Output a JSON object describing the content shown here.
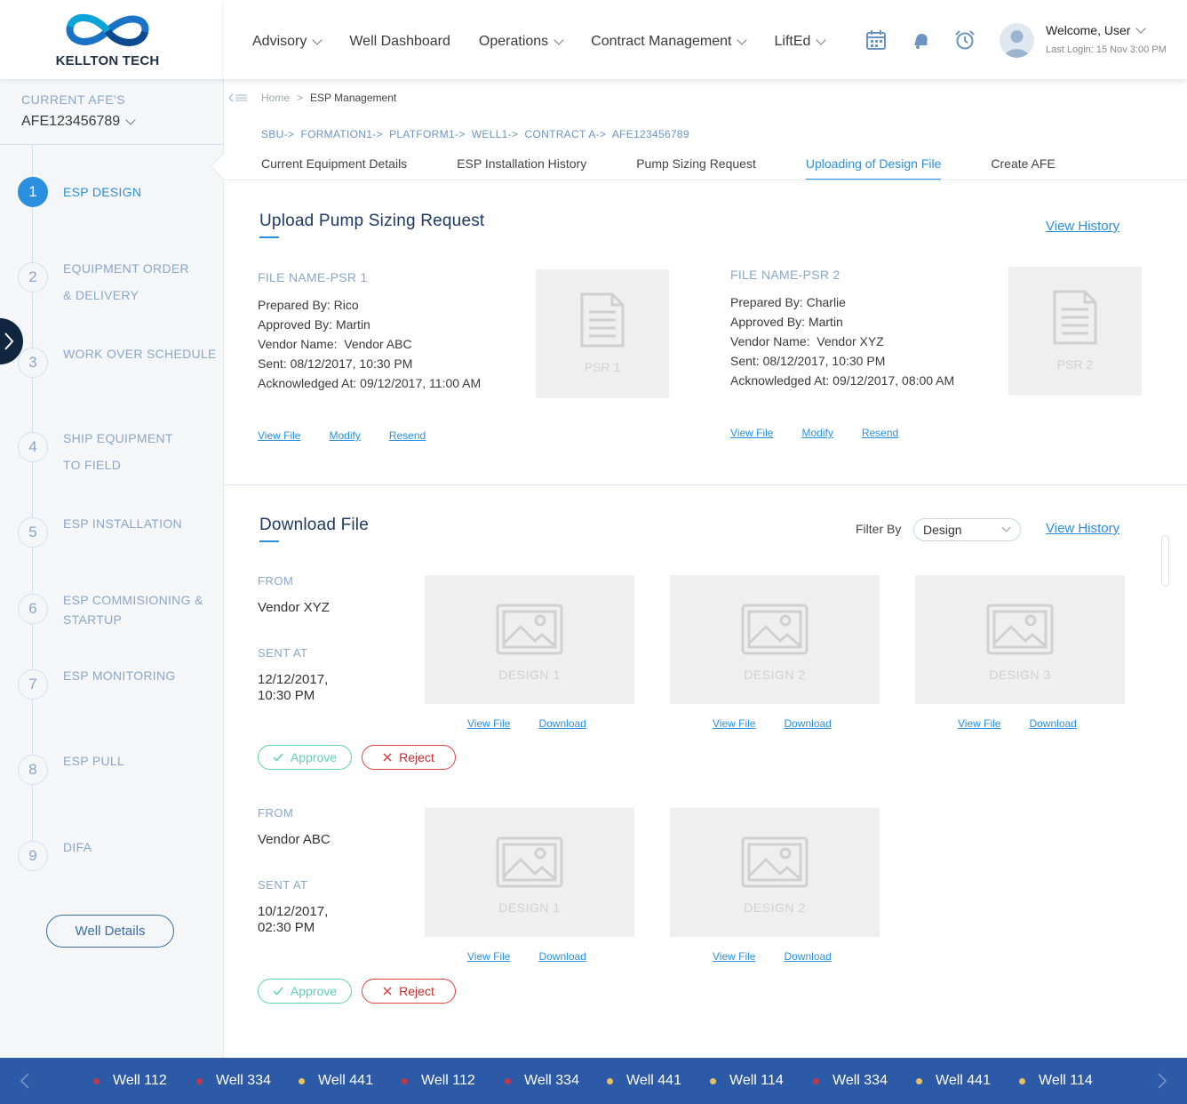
{
  "brand": {
    "logo_text": "KELLTON TECH"
  },
  "sidebar": {
    "afe_label": "CURRENT AFE'S",
    "afe_value": "AFE123456789",
    "steps": [
      {
        "num": "1",
        "label": "ESP DESIGN"
      },
      {
        "num": "2",
        "label": "EQUIPMENT ORDER\n& DELIVERY"
      },
      {
        "num": "3",
        "label": "WORK OVER SCHEDULE"
      },
      {
        "num": "4",
        "label": "SHIP EQUIPMENT\nTO FIELD"
      },
      {
        "num": "5",
        "label": "ESP INSTALLATION"
      },
      {
        "num": "6",
        "label": "ESP COMMISIONING &\nSTARTUP"
      },
      {
        "num": "7",
        "label": "ESP MONITORING"
      },
      {
        "num": "8",
        "label": "ESP PULL"
      },
      {
        "num": "9",
        "label": "DIFA"
      }
    ],
    "active_step": "1",
    "well_details_label": "Well Details"
  },
  "header": {
    "nav": [
      "Advisory",
      "Well Dashboard",
      "Operations",
      "Contract Management",
      "LiftEd"
    ],
    "icons": [
      "calendar-icon",
      "bell-icon",
      "alarm-clock-icon"
    ],
    "welcome": "Welcome, User",
    "last_login": "Last Login: 15 Nov 3:00 PM"
  },
  "breadcrumb": {
    "home": "Home",
    "sep": ">",
    "current": "ESP Management"
  },
  "path": "SBU->  FORMATION1->  PLATFORM1->  WELL1->  CONTRACT A->  AFE123456789",
  "tabs": [
    "Current Equipment Details",
    "ESP Installation History",
    "Pump Sizing Request",
    "Uploading of Design File",
    "Create AFE"
  ],
  "active_tab": "Uploading of Design File",
  "upload": {
    "title": "Upload Pump Sizing Request",
    "view_history": "View History",
    "files": [
      {
        "name": "FILE NAME-PSR 1",
        "prepared_by": "Prepared By: Rico",
        "approved_by": "Approved By: Martin",
        "vendor": "Vendor Name:  Vendor ABC",
        "sent": "Sent: 08/12/2017, 10:30 PM",
        "acknowledged": "Acknowledged At: 09/12/2017, 11:00 AM",
        "thumb_label": "PSR 1",
        "links": [
          "View File",
          "Modify",
          "Resend"
        ]
      },
      {
        "name": "FILE NAME-PSR 2",
        "prepared_by": "Prepared By: Charlie",
        "approved_by": "Approved By: Martin",
        "vendor": "Vendor Name:  Vendor XYZ",
        "sent": "Sent: 08/12/2017, 10:30 PM",
        "acknowledged": "Acknowledged At: 09/12/2017, 08:00 AM",
        "thumb_label": "PSR 2",
        "links": [
          "View File",
          "Modify",
          "Resend"
        ]
      }
    ]
  },
  "download": {
    "title": "Download File",
    "filter_label": "Filter By",
    "filter_value": "Design",
    "view_history": "View History",
    "from_label": "FROM",
    "sent_label": "SENT AT",
    "approve_label": "Approve",
    "reject_label": "Reject",
    "file_links": [
      "View File",
      "Download"
    ],
    "groups": [
      {
        "vendor": "Vendor XYZ",
        "sent_date": "12/12/2017,",
        "sent_time": "10:30 PM",
        "designs": [
          "DESIGN 1",
          "DESIGN 2",
          "DESIGN 3"
        ]
      },
      {
        "vendor": "Vendor ABC",
        "sent_date": "10/12/2017,",
        "sent_time": "02:30 PM",
        "designs": [
          "DESIGN 1",
          "DESIGN 2"
        ]
      }
    ]
  },
  "ticker": {
    "items": [
      {
        "label": "Well 112",
        "status": "red"
      },
      {
        "label": "Well 334",
        "status": "red"
      },
      {
        "label": "Well 441",
        "status": "yellow"
      },
      {
        "label": "Well 112",
        "status": "red"
      },
      {
        "label": "Well 334",
        "status": "red"
      },
      {
        "label": "Well 441",
        "status": "yellow"
      },
      {
        "label": "Well 114",
        "status": "yellow"
      },
      {
        "label": "Well 334",
        "status": "red"
      },
      {
        "label": "Well 441",
        "status": "yellow"
      },
      {
        "label": "Well 114",
        "status": "yellow"
      }
    ]
  },
  "colors": {
    "accent": "#2b8fe0",
    "ticker_bg": "#2d5aa6",
    "status_red": "#c0394b",
    "status_yellow": "#e6c35c",
    "approve": "#5fd0b0",
    "reject": "#e04040"
  }
}
